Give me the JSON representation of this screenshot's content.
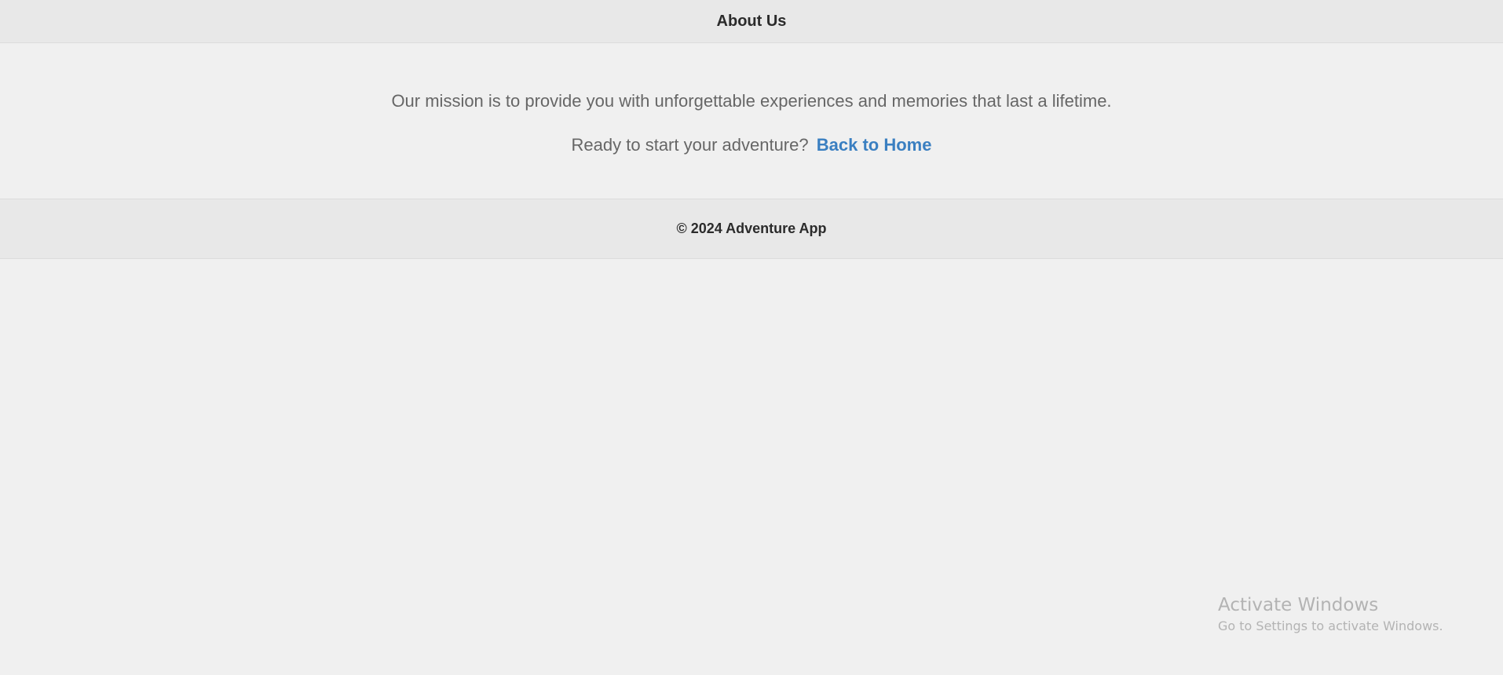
{
  "header": {
    "title": "About Us"
  },
  "main": {
    "mission_text": "Our mission is to provide you with unforgettable experiences and memories that last a lifetime.",
    "cta_text": "Ready to start your adventure?",
    "cta_link_label": "Back to Home"
  },
  "footer": {
    "copyright": "© 2024 Adventure App"
  },
  "watermark": {
    "title": "Activate Windows",
    "subtitle": "Go to Settings to activate Windows."
  },
  "colors": {
    "background": "#f0f0f0",
    "header_bg": "#e8e8e8",
    "link": "#3a7fc1",
    "body_text": "#666666"
  }
}
